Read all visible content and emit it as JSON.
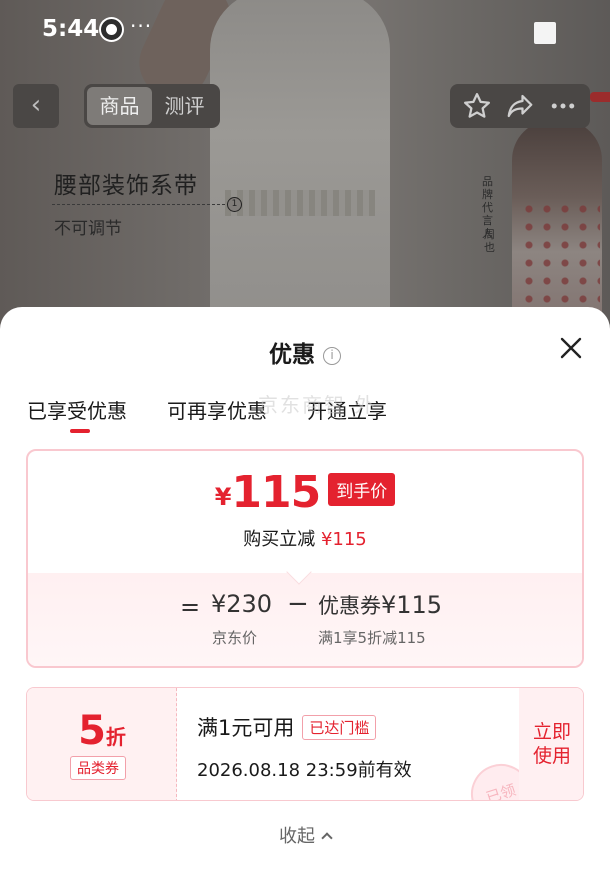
{
  "status_bar": {
    "time": "5:44",
    "dots": "···"
  },
  "nav": {
    "back_icon": "chevron-left-icon",
    "tabs": [
      {
        "label": "商品"
      },
      {
        "label": "测评"
      }
    ],
    "right_icons": [
      "star-icon",
      "share-icon",
      "more-icon"
    ]
  },
  "product_image": {
    "feature_title": "腰部装饰系带",
    "feature_number": "1",
    "feature_sub": "不可调节",
    "endorse_text_1": "品牌代言人",
    "endorse_text_2": "周也"
  },
  "sheet": {
    "title": "优惠",
    "info_icon": "i",
    "tabs": [
      {
        "label": "已享受优惠"
      },
      {
        "label": "可再享优惠"
      },
      {
        "label": "开通立享"
      }
    ],
    "watermark": "京东商智 外",
    "final_price": {
      "currency": "¥",
      "amount": "115",
      "badge": "到手价",
      "saving_prefix": "购买立减",
      "saving_value": "¥115"
    },
    "breakdown": {
      "equals": "=",
      "original_price": "¥230",
      "original_label": "京东价",
      "minus": "−",
      "coupon_prefix": "优惠券",
      "coupon_value": "¥115",
      "coupon_desc": "满1享5折减115"
    },
    "coupon": {
      "discount_number": "5",
      "discount_unit": "折",
      "type": "品类券",
      "condition": "满1元可用",
      "condition_tag": "已达门槛",
      "expiry": "2026.08.18 23:59前有效",
      "use_label_1": "立即",
      "use_label_2": "使用",
      "stamp": "已领"
    },
    "collapse_label": "收起"
  },
  "colors": {
    "accent": "#e4222f",
    "card_border": "#f9c8cf",
    "card_tint": "#fff0f1"
  }
}
